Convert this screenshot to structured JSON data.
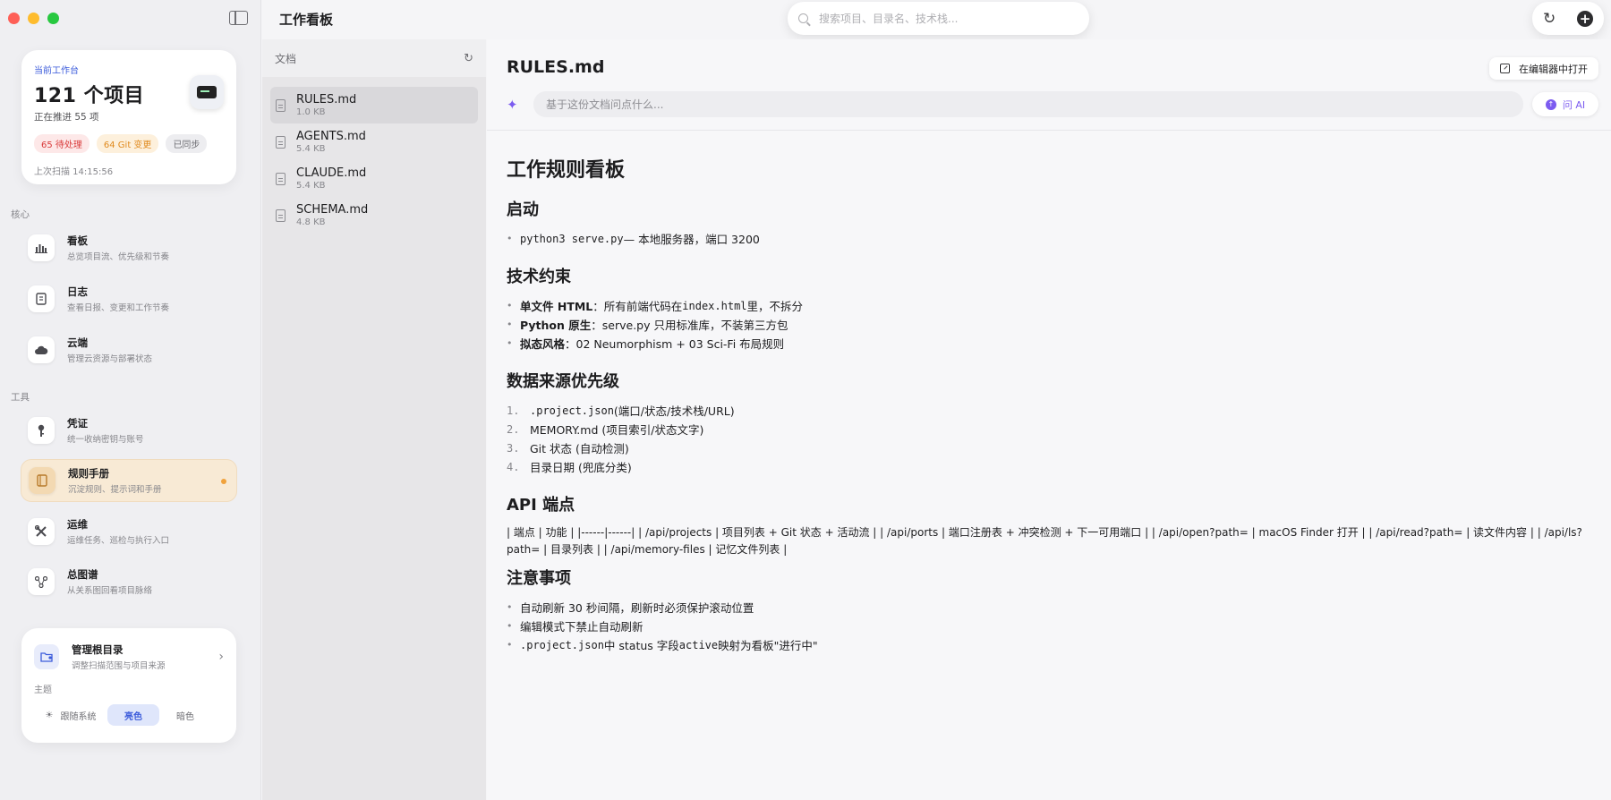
{
  "window": {
    "title": "工作看板"
  },
  "search": {
    "placeholder": "搜索项目、目录名、技术栈..."
  },
  "workspace": {
    "label": "当前工作台",
    "count": "121 个项目",
    "sub": "正在推进 55 项",
    "badges": {
      "pending": "65 待处理",
      "git": "64 Git 变更",
      "sync": "已同步"
    },
    "last_scan": "上次扫描 14:15:56"
  },
  "sections": {
    "core": "核心",
    "tools": "工具"
  },
  "nav": {
    "board": {
      "title": "看板",
      "desc": "总览项目流、优先级和节奏",
      "icon": "bar-chart-icon"
    },
    "log": {
      "title": "日志",
      "desc": "查看日报、变更和工作节奏",
      "icon": "book-icon"
    },
    "cloud": {
      "title": "云端",
      "desc": "管理云资源与部署状态",
      "icon": "cloud-icon"
    },
    "credentials": {
      "title": "凭证",
      "desc": "统一收纳密钥与账号",
      "icon": "key-icon"
    },
    "rules": {
      "title": "规则手册",
      "desc": "沉淀规则、提示词和手册",
      "icon": "handbook-icon"
    },
    "ops": {
      "title": "运维",
      "desc": "运维任务、巡检与执行入口",
      "icon": "wrench-icon"
    },
    "graph": {
      "title": "总图谱",
      "desc": "从关系图回看项目脉络",
      "icon": "graph-icon"
    }
  },
  "root": {
    "title": "管理根目录",
    "desc": "调整扫描范围与项目来源"
  },
  "theme": {
    "label": "主题",
    "system": "跟随系统",
    "light": "亮色",
    "dark": "暗色"
  },
  "docs": {
    "title": "文档",
    "items": [
      {
        "name": "RULES.md",
        "size": "1.0 KB"
      },
      {
        "name": "AGENTS.md",
        "size": "5.4 KB"
      },
      {
        "name": "CLAUDE.md",
        "size": "5.4 KB"
      },
      {
        "name": "SCHEMA.md",
        "size": "4.8 KB"
      }
    ]
  },
  "main": {
    "doc_title": "RULES.md",
    "open_editor": "在编辑器中打开",
    "ask_placeholder": "基于这份文档问点什么...",
    "ask_button": "问 AI"
  },
  "content": {
    "h1": "工作规则看板",
    "start": {
      "h": "启动",
      "code": "python3 serve.py",
      "text": " — 本地服务器，端口 3200"
    },
    "tech": {
      "h": "技术约束",
      "i1_b": "单文件 HTML",
      "i1_a": "：所有前端代码在 ",
      "i1_code": "index.html",
      "i1_c": " 里，不拆分",
      "i2_b": "Python 原生",
      "i2_a": "：serve.py 只用标准库，不装第三方包",
      "i3_b": "拟态风格",
      "i3_a": "：02 Neumorphism + 03 Sci-Fi 布局规则"
    },
    "sources": {
      "h": "数据来源优先级",
      "items": [
        {
          "n": "1.",
          "code": ".project.json",
          "t": " (端口/状态/技术栈/URL)"
        },
        {
          "n": "2.",
          "code": "",
          "t": "MEMORY.md (项目索引/状态文字)"
        },
        {
          "n": "3.",
          "code": "",
          "t": "Git 状态 (自动检测)"
        },
        {
          "n": "4.",
          "code": "",
          "t": "目录日期 (兜底分类)"
        }
      ]
    },
    "api": {
      "h": "API 端点",
      "raw": "| 端点 | 功能 | |------|------| | /api/projects | 项目列表 + Git 状态 + 活动流 | | /api/ports | 端口注册表 + 冲突检测 + 下一可用端口 | | /api/open?path= | macOS Finder 打开 | | /api/read?path= | 读文件内容 | | /api/ls?path= | 目录列表 | | /api/memory-files | 记忆文件列表 |"
    },
    "notes": {
      "h": "注意事项",
      "i1": "自动刷新 30 秒间隔，刷新时必须保护滚动位置",
      "i2": "编辑模式下禁止自动刷新",
      "i3_code": ".project.json",
      "i3_a": " 中 status 字段 ",
      "i3_code2": "active",
      "i3_b": " 映射为看板\"进行中\""
    }
  },
  "colors": {
    "accent": "#3b5bdb",
    "ai": "#7c5cf0",
    "active_nav": "#f8ead5",
    "dot": "#f0a23c"
  }
}
